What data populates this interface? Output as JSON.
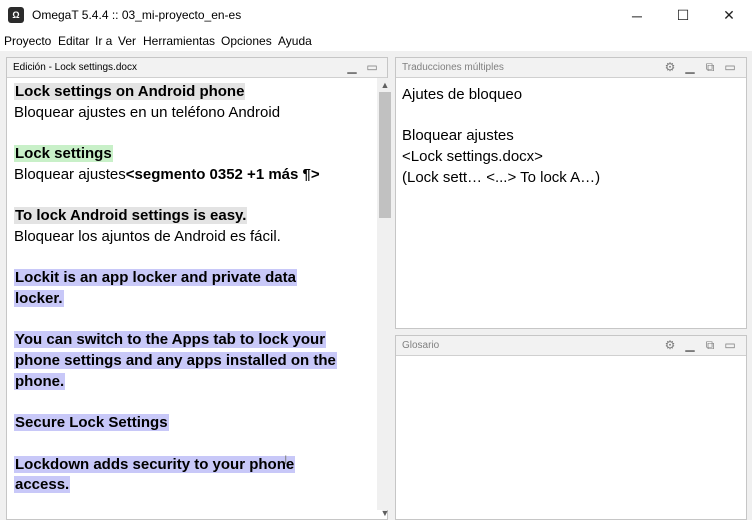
{
  "window": {
    "title": "OmegaT 5.4.4 :: 03_mi-proyecto_en-es",
    "minimize": "─",
    "maximize": "☐",
    "close": "✕"
  },
  "menu": [
    "Proyecto",
    "Editar",
    "Ir a",
    "Ver",
    "Herramientas",
    "Opciones",
    "Ayuda"
  ],
  "editor": {
    "title": "Edición - Lock settings.docx",
    "source1": "Lock settings on Android phone",
    "target1": "Bloquear ajustes en un teléfono Android",
    "source2": "Lock settings",
    "target2_text": "Bloquear ajustes",
    "target2_tag": "<segmento 0352 +1 más ¶>",
    "source3": "To lock Android settings is easy.",
    "target3": "Bloquear los ajuntos de Android es fácil.",
    "seg4_line1": "Lockit is an app locker and private data",
    "seg4_line2": "locker.",
    "seg5_line1": "You can switch to the Apps tab to lock your",
    "seg5_line2": "phone settings and any apps installed on the",
    "seg5_line3": "phone.",
    "seg6": "Secure Lock Settings",
    "seg7_line1": "Lockdown adds security to your phone",
    "seg7_line2": "access."
  },
  "multiple_translations": {
    "title": "Traducciones múltiples",
    "line1": "Ajutes de bloqueo",
    "line2": "Bloquear ajustes",
    "line3": "<Lock settings.docx>",
    "line4": "(Lock sett… <...> To lock A…)"
  },
  "glossary": {
    "title": "Glosario"
  },
  "colors": {
    "source_highlight": "#e3e3e3",
    "active_segment": "#c8f0c8",
    "untranslated_segment": "#c8c8f8"
  }
}
